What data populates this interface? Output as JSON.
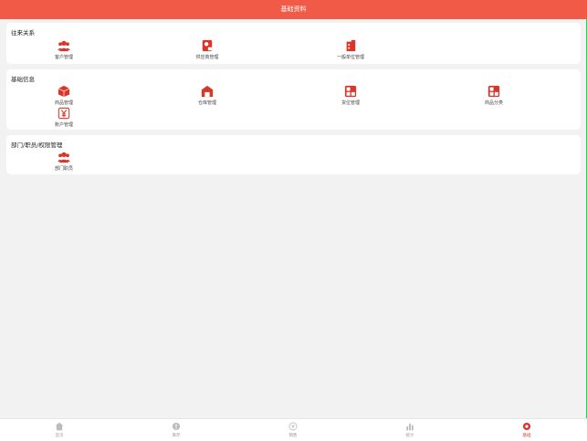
{
  "header": {
    "title": "基础资料"
  },
  "sections": [
    {
      "title": "往来关系",
      "items": [
        {
          "label": "客户管理",
          "icon": "users-icon"
        },
        {
          "label": "供应商管理",
          "icon": "supplier-icon"
        },
        {
          "label": "一般单位管理",
          "icon": "building-icon"
        }
      ]
    },
    {
      "title": "基础信息",
      "items": [
        {
          "label": "商品管理",
          "icon": "box-icon"
        },
        {
          "label": "仓库管理",
          "icon": "warehouse-icon"
        },
        {
          "label": "货位管理",
          "icon": "grid-icon"
        },
        {
          "label": "商品分类",
          "icon": "category-icon"
        },
        {
          "label": "账户管理",
          "icon": "yen-icon"
        }
      ]
    },
    {
      "title": "部门/职员/权限管理",
      "items": [
        {
          "label": "部门职员",
          "icon": "users-icon"
        }
      ]
    }
  ],
  "tabs": [
    {
      "label": "首页",
      "icon": "home-icon",
      "active": false
    },
    {
      "label": "库存",
      "icon": "stock-icon",
      "active": false
    },
    {
      "label": "销售",
      "icon": "sales-icon",
      "active": false
    },
    {
      "label": "统计",
      "icon": "chart-icon",
      "active": false
    },
    {
      "label": "基础",
      "icon": "base-icon",
      "active": true
    }
  ],
  "colors": {
    "brand": "#f05a47",
    "icon_red": "#d9362b",
    "active_tab": "#e0332c"
  }
}
